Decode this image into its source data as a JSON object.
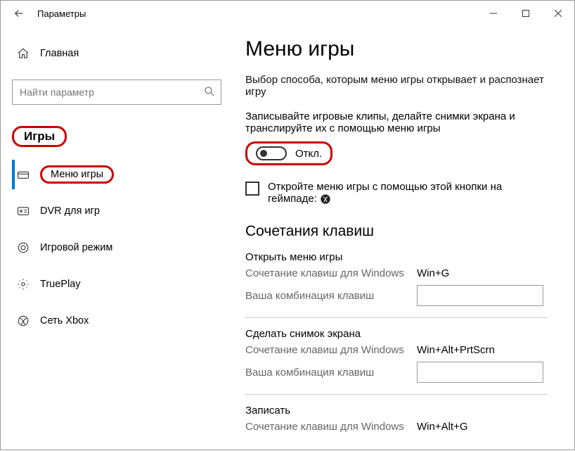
{
  "window": {
    "title": "Параметры"
  },
  "sidebar": {
    "home": "Главная",
    "search_placeholder": "Найти параметр",
    "category": "Игры",
    "items": [
      {
        "label": "Меню игры"
      },
      {
        "label": "DVR для игр"
      },
      {
        "label": "Игровой режим"
      },
      {
        "label": "TruePlay"
      },
      {
        "label": "Сеть Xbox"
      }
    ]
  },
  "page": {
    "title": "Меню игры",
    "description": "Выбор способа, которым меню игры открывает и распознает игру",
    "record_label": "Записывайте игровые клипы, делайте снимки экрана и транслируйте их с помощью меню игры",
    "toggle_state": "Откл.",
    "checkbox_label_a": "Откройте меню игры с помощью этой кнопки на геймпаде:",
    "shortcuts_heading": "Сочетания клавиш",
    "groups": [
      {
        "title": "Открыть меню игры",
        "win_label": "Сочетание клавиш для Windows",
        "win_val": "Win+G",
        "user_label": "Ваша комбинация клавиш",
        "user_val": ""
      },
      {
        "title": "Сделать снимок экрана",
        "win_label": "Сочетание клавиш для Windows",
        "win_val": "Win+Alt+PrtScrn",
        "user_label": "Ваша комбинация клавиш",
        "user_val": ""
      },
      {
        "title": "Записать",
        "win_label": "Сочетание клавиш для Windows",
        "win_val": "Win+Alt+G",
        "user_label": "",
        "user_val": ""
      }
    ]
  }
}
